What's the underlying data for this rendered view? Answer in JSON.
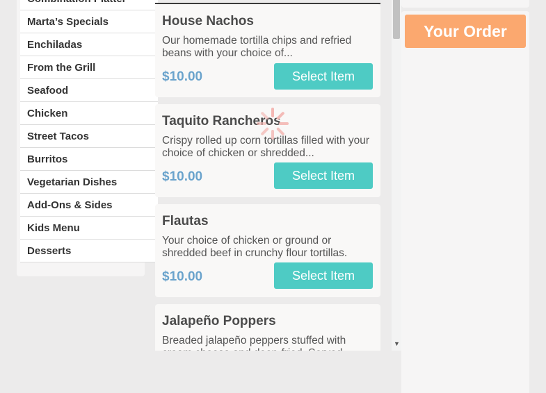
{
  "categories": [
    {
      "label": "Combination Platter"
    },
    {
      "label": "Marta’s Specials"
    },
    {
      "label": "Enchiladas"
    },
    {
      "label": "From the Grill"
    },
    {
      "label": "Seafood"
    },
    {
      "label": "Chicken"
    },
    {
      "label": "Street Tacos"
    },
    {
      "label": "Burritos"
    },
    {
      "label": "Vegetarian Dishes"
    },
    {
      "label": "Add-Ons & Sides"
    },
    {
      "label": "Kids Menu"
    },
    {
      "label": "Desserts"
    }
  ],
  "menu_items": [
    {
      "title": "House Nachos",
      "desc": "Our homemade tortilla chips and refried beans with your choice of...",
      "price": "$10.00",
      "button": "Select Item"
    },
    {
      "title": "Taquito Rancheros",
      "desc": "Crispy rolled up corn tortillas filled with your choice of chicken or shredded...",
      "price": "$10.00",
      "button": "Select Item"
    },
    {
      "title": "Flautas",
      "desc": "Your choice of chicken or ground or shredded beef in crunchy flour tortillas.",
      "price": "$10.00",
      "button": "Select Item"
    },
    {
      "title": "Jalapeño Poppers",
      "desc": "Breaded jalapeño peppers stuffed with cream cheese and deep-fried. Served",
      "price": "",
      "button": ""
    }
  ],
  "order": {
    "button_label": "Your Order"
  },
  "colors": {
    "accent_teal": "#4ecbc4",
    "accent_orange": "#fba86f",
    "price_blue": "#6aa3cc",
    "spinner": "#f4b8b4"
  },
  "icons": {
    "loading": "loading-spinner-icon",
    "scroll_down": "scroll-down-arrow-icon"
  }
}
